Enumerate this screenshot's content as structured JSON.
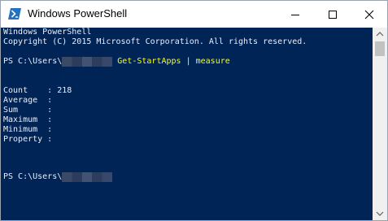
{
  "window": {
    "title": "Windows PowerShell"
  },
  "console": {
    "lines": [
      "Windows PowerShell",
      "Copyright (C) 2015 Microsoft Corporation. All rights reserved.",
      "",
      "",
      "",
      "Count    : 218",
      "Average  :",
      "Sum      :",
      "Maximum  :",
      "Minimum  :",
      "Property :"
    ],
    "prompt1_prefix": "PS C:\\Users\\",
    "prompt1_command": "Get-StartApps | measure",
    "prompt2_prefix": "PS C:\\Users\\"
  },
  "colors": {
    "console_bg": "#012456",
    "console_text": "#eeedf0",
    "command_text": "#ffff00"
  },
  "icons": {
    "app": "powershell-icon",
    "minimize": "minimize-icon",
    "maximize": "maximize-icon",
    "close": "close-icon"
  }
}
